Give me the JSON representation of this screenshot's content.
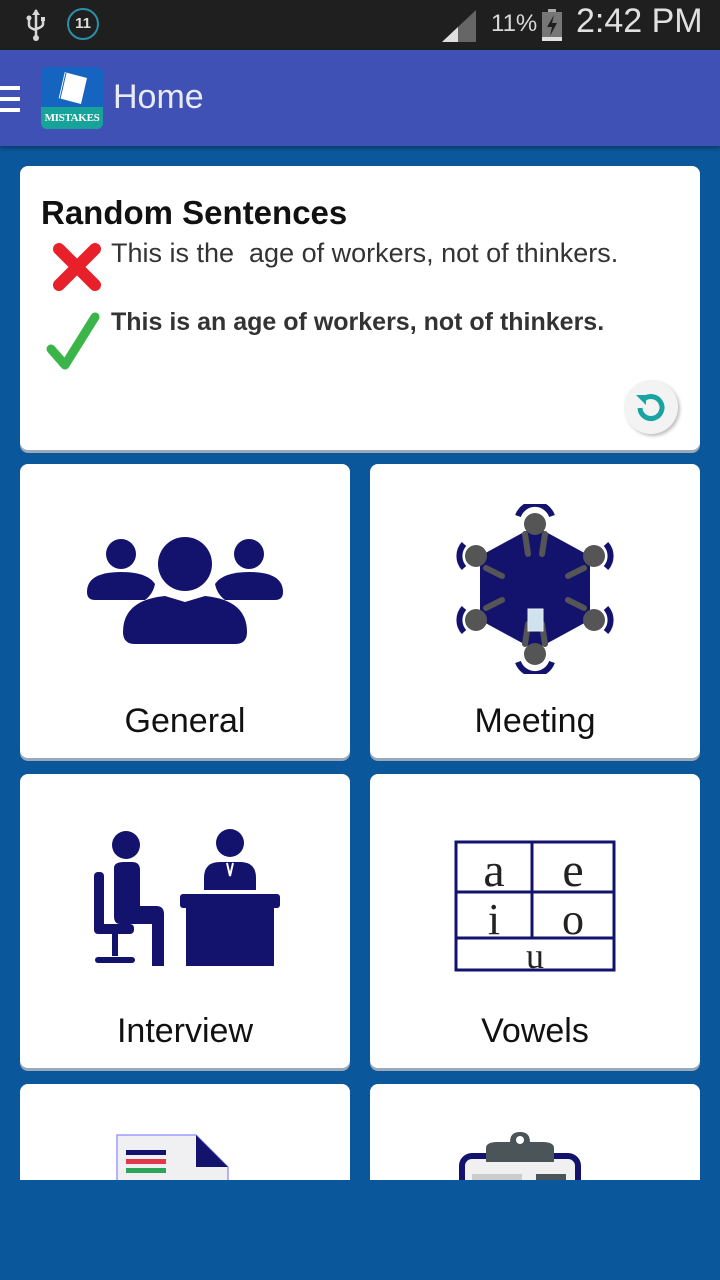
{
  "status_bar": {
    "notification_count": "11",
    "battery_percent": "11%",
    "time": "2:42 PM",
    "icons": [
      "usb-icon",
      "notification-count-icon",
      "signal-icon",
      "battery-charging-icon"
    ]
  },
  "app_bar": {
    "title": "Home",
    "logo_text": "MISTAKES",
    "menu_icon": "hamburger-menu-icon"
  },
  "random_sentences": {
    "title": "Random Sentences",
    "wrong_sentence": "This is the  age of workers, not of thinkers.",
    "correct_sentence": "This is an age of workers, not of thinkers.",
    "wrong_icon": "cross-icon",
    "correct_icon": "check-icon",
    "refresh_icon": "refresh-icon",
    "colors": {
      "wrong": "#e8202a",
      "correct": "#3bb54a",
      "refresh": "#1aa3a3"
    }
  },
  "categories": [
    {
      "label": "General",
      "icon": "group-icon"
    },
    {
      "label": "Meeting",
      "icon": "meeting-table-icon"
    },
    {
      "label": "Interview",
      "icon": "interview-icon"
    },
    {
      "label": "Vowels",
      "icon": "vowels-grid-icon",
      "letters": [
        "a",
        "e",
        "i",
        "o",
        "u"
      ]
    },
    {
      "label": "",
      "icon": "document-icon"
    },
    {
      "label": "",
      "icon": "clipboard-icon"
    }
  ],
  "theme": {
    "background": "#0b579b",
    "app_bar": "#3f51b5",
    "icon_navy": "#13136e"
  }
}
